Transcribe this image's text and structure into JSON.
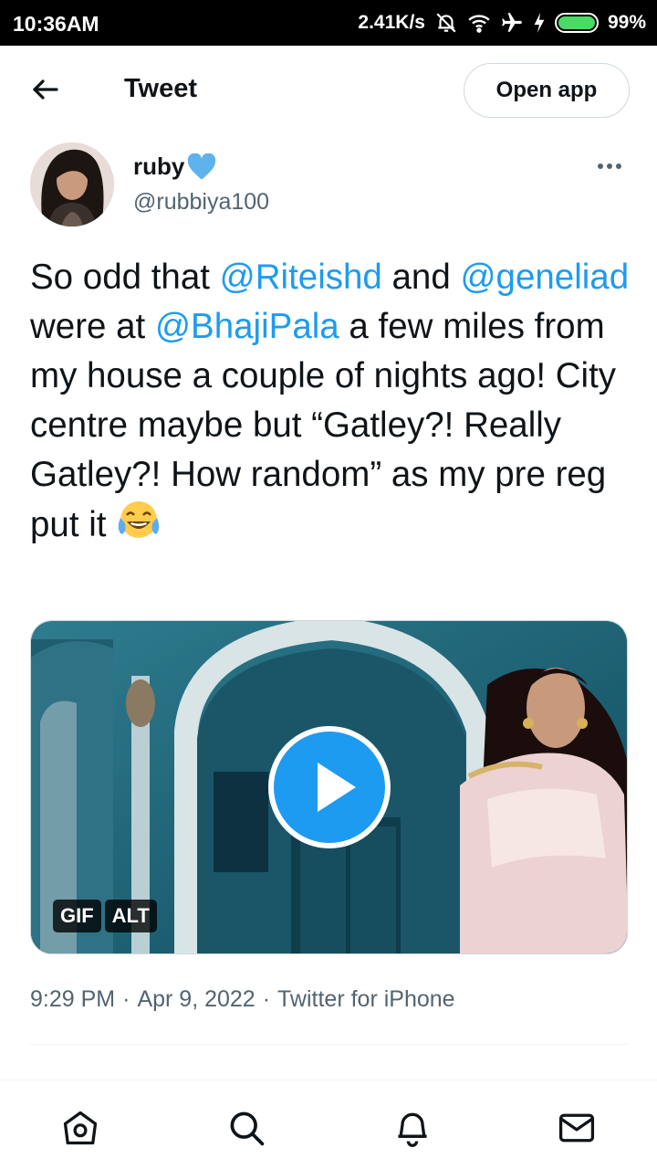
{
  "status_bar": {
    "time": "10:36AM",
    "network_speed": "2.41K/s",
    "battery_percent": "99%",
    "battery_level": 0.99,
    "icons": [
      "mute-icon",
      "wifi-icon",
      "airplane-icon",
      "charging-icon",
      "battery-icon"
    ]
  },
  "header": {
    "title": "Tweet",
    "open_app_label": "Open app",
    "back_icon": "arrow-left-icon"
  },
  "tweet": {
    "display_name": "ruby",
    "handle": "@rubbiya100",
    "text_parts": {
      "p1": "So odd that ",
      "m1": "@Riteishd",
      "p2": " and ",
      "m2": "@geneliad",
      "p3": " were at ",
      "m3": "@BhajiPala",
      "p4": " a few miles from my house a couple of nights ago! City centre maybe but “Gatley?! Really Gatley?! How random” as my pre reg put it "
    },
    "media": {
      "badges": {
        "gif": "GIF",
        "alt": "ALT"
      }
    },
    "time": "9:29 PM",
    "separator1": "·",
    "date": "Apr 9, 2022",
    "separator2": "·",
    "source": "Twitter for iPhone"
  },
  "bottom_nav": {
    "items": [
      "home-icon",
      "search-icon",
      "notifications-icon",
      "messages-icon"
    ]
  },
  "colors": {
    "accent": "#1d9bf0",
    "text": "#0f1419",
    "secondary": "#536471",
    "border": "#cfd9de"
  }
}
